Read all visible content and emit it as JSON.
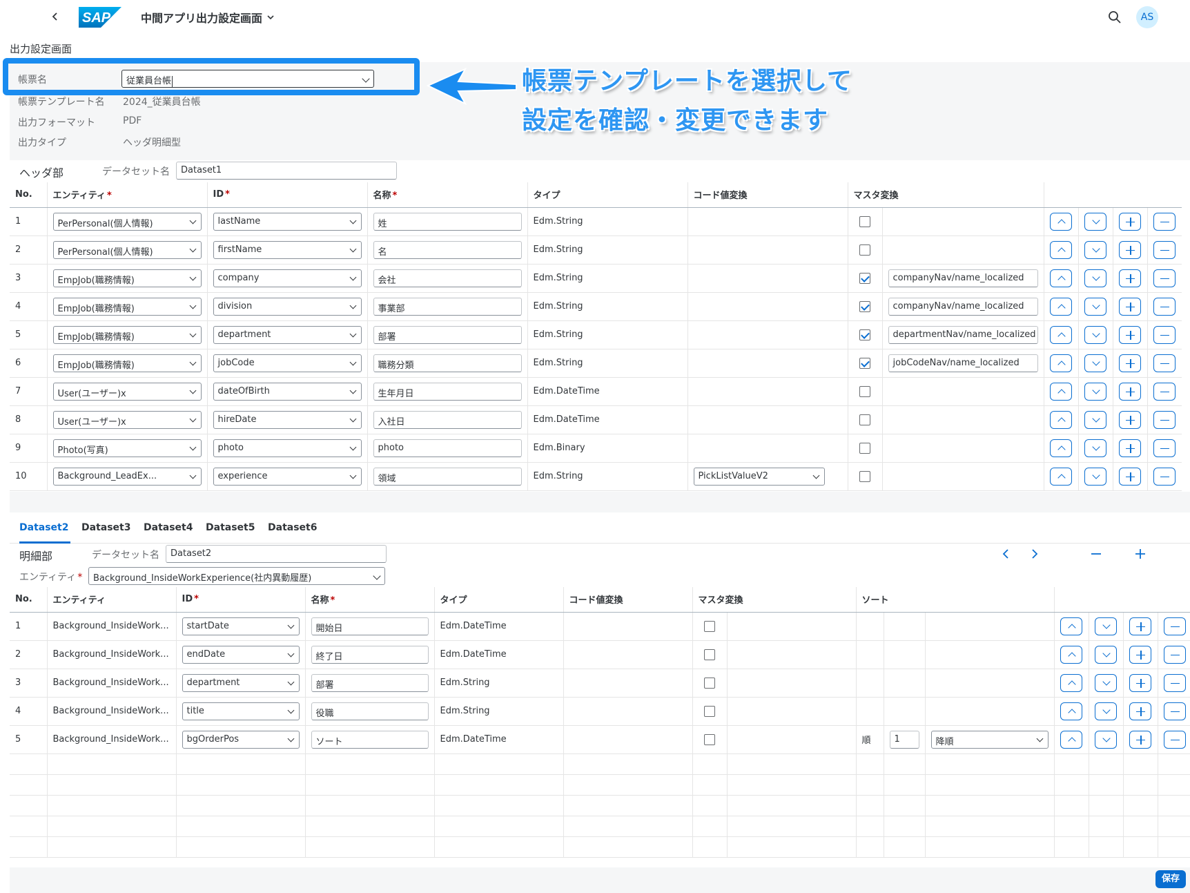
{
  "app": {
    "title": "中間アプリ出力設定画面",
    "avatar": "AS",
    "brand": "SAP"
  },
  "page": {
    "title": "出力設定画面"
  },
  "header_form": {
    "report_name_label": "帳票名",
    "report_name_value": "従業員台帳",
    "template_label": "帳票テンプレート名",
    "template_value": "2024_従業員台帳",
    "format_label": "出力フォーマット",
    "format_value": "PDF",
    "type_label": "出力タイプ",
    "type_value": "ヘッダ明細型"
  },
  "annotation": {
    "line1": "帳票テンプレートを選択して",
    "line2": "設定を確認・変更できます"
  },
  "header_section": {
    "title": "ヘッダ部",
    "dataset_label": "データセット名",
    "dataset_value": "Dataset1",
    "columns": {
      "no": "No.",
      "entity": "エンティティ",
      "id": "ID",
      "name": "名称",
      "type": "タイプ",
      "code": "コード値変換",
      "master": "マスタ変換"
    },
    "rows": [
      {
        "no": "1",
        "entity": "PerPersonal(個人情報)",
        "id": "lastName",
        "name": "姓",
        "type": "Edm.String",
        "code": "",
        "checked": false,
        "master": ""
      },
      {
        "no": "2",
        "entity": "PerPersonal(個人情報)",
        "id": "firstName",
        "name": "名",
        "type": "Edm.String",
        "code": "",
        "checked": false,
        "master": ""
      },
      {
        "no": "3",
        "entity": "EmpJob(職務情報)",
        "id": "company",
        "name": "会社",
        "type": "Edm.String",
        "code": "",
        "checked": true,
        "master": "companyNav/name_localized"
      },
      {
        "no": "4",
        "entity": "EmpJob(職務情報)",
        "id": "division",
        "name": "事業部",
        "type": "Edm.String",
        "code": "",
        "checked": true,
        "master": "companyNav/name_localized"
      },
      {
        "no": "5",
        "entity": "EmpJob(職務情報)",
        "id": "department",
        "name": "部署",
        "type": "Edm.String",
        "code": "",
        "checked": true,
        "master": "departmentNav/name_localized"
      },
      {
        "no": "6",
        "entity": "EmpJob(職務情報)",
        "id": "jobCode",
        "name": "職務分類",
        "type": "Edm.String",
        "code": "",
        "checked": true,
        "master": "jobCodeNav/name_localized"
      },
      {
        "no": "7",
        "entity": "User(ユーザー)x",
        "id": "dateOfBirth",
        "name": "生年月日",
        "type": "Edm.DateTime",
        "code": "",
        "checked": false,
        "master": ""
      },
      {
        "no": "8",
        "entity": "User(ユーザー)x",
        "id": "hireDate",
        "name": "入社日",
        "type": "Edm.DateTime",
        "code": "",
        "checked": false,
        "master": ""
      },
      {
        "no": "9",
        "entity": "Photo(写真)",
        "id": "photo",
        "name": "photo",
        "type": "Edm.Binary",
        "code": "",
        "checked": false,
        "master": ""
      },
      {
        "no": "10",
        "entity": "Background_LeadEx...",
        "id": "experience",
        "name": "領域",
        "type": "Edm.String",
        "code": "PickListValueV2",
        "checked": false,
        "master": ""
      }
    ]
  },
  "tabs": [
    "Dataset2",
    "Dataset3",
    "Dataset4",
    "Dataset5",
    "Dataset6"
  ],
  "detail_section": {
    "title": "明細部",
    "dataset_label": "データセット名",
    "dataset_value": "Dataset2",
    "entity_label": "エンティティ",
    "entity_value": "Background_InsideWorkExperience(社内異動履歴)",
    "columns": {
      "no": "No.",
      "entity": "エンティティ",
      "id": "ID",
      "name": "名称",
      "type": "タイプ",
      "code": "コード値変換",
      "master": "マスタ変換",
      "sort": "ソート"
    },
    "rows": [
      {
        "no": "1",
        "entity": "Background_InsideWork...",
        "id": "startDate",
        "name": "開始日",
        "type": "Edm.DateTime",
        "checked": false,
        "sort_label": "",
        "sort_order": "",
        "sort_dir": ""
      },
      {
        "no": "2",
        "entity": "Background_InsideWork...",
        "id": "endDate",
        "name": "終了日",
        "type": "Edm.DateTime",
        "checked": false,
        "sort_label": "",
        "sort_order": "",
        "sort_dir": ""
      },
      {
        "no": "3",
        "entity": "Background_InsideWork...",
        "id": "department",
        "name": "部署",
        "type": "Edm.String",
        "checked": false,
        "sort_label": "",
        "sort_order": "",
        "sort_dir": ""
      },
      {
        "no": "4",
        "entity": "Background_InsideWork...",
        "id": "title",
        "name": "役職",
        "type": "Edm.String",
        "checked": false,
        "sort_label": "",
        "sort_order": "",
        "sort_dir": ""
      },
      {
        "no": "5",
        "entity": "Background_InsideWork...",
        "id": "bgOrderPos",
        "name": "ソート",
        "type": "Edm.DateTime",
        "checked": false,
        "sort_label": "順",
        "sort_order": "1",
        "sort_dir": "降順"
      }
    ]
  },
  "footer": {
    "save_label": "保存"
  },
  "colors": {
    "accent": "#0a6ed1",
    "annotation": "#1a8cf0",
    "required": "#bb0000"
  }
}
